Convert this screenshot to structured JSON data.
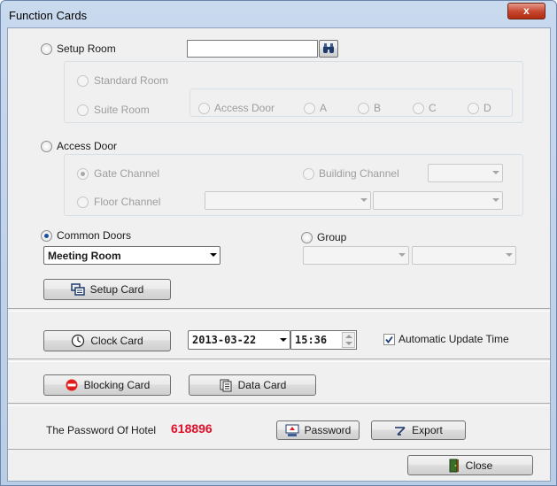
{
  "window": {
    "title": "Function Cards",
    "close_label": "x"
  },
  "setup_room": {
    "label": "Setup Room",
    "room_input_value": "",
    "standard_room": "Standard Room",
    "suite_room": "Suite Room",
    "suite_options": [
      "Access Door",
      "A",
      "B",
      "C",
      "D"
    ]
  },
  "access_door": {
    "label": "Access Door",
    "gate_channel": "Gate Channel",
    "building_channel": "Building Channel",
    "floor_channel": "Floor Channel"
  },
  "common_doors": {
    "label": "Common Doors",
    "selected": "Meeting Room",
    "group_label": "Group",
    "setup_card_button": "Setup Card"
  },
  "clock": {
    "clock_card_button": "Clock Card",
    "date": "2013-03-22",
    "time": "15:36",
    "auto_update_label": "Automatic Update Time",
    "auto_update_checked": true
  },
  "cards": {
    "blocking_card_button": "Blocking Card",
    "data_card_button": "Data Card"
  },
  "hotel": {
    "password_label": "The Password Of Hotel",
    "password_value": "618896",
    "password_button": "Password",
    "export_button": "Export"
  },
  "footer": {
    "close_button": "Close"
  },
  "colors": {
    "password_red": "#e0102a",
    "radio_selected": "#1d4fa0"
  }
}
